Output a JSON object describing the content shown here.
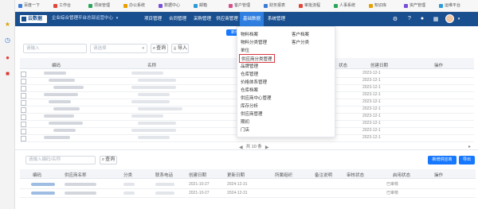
{
  "bookmarks": {
    "items": [
      "百度一下",
      "工作台",
      "项目管理",
      "办公系统",
      "数据中心",
      "邮箱",
      "客户管理",
      "财务报表",
      "审批流程",
      "人事系统",
      "知识库",
      "资产管理",
      "运维平台"
    ]
  },
  "topnav": {
    "brand": "云数据",
    "subtitle": "企业综合管理平台",
    "tenant": "总部运营中心",
    "items": [
      "项目管理",
      "合同管理",
      "采购管理",
      "供应商管理",
      "基础数据",
      "系统管理"
    ],
    "active_index": 4
  },
  "filter": {
    "field1_placeholder": "请输入",
    "field2_placeholder": "请选择",
    "search_label": "查询",
    "import_label": "导入",
    "top_button_label": "新增"
  },
  "dropdown": {
    "col1": [
      "物料档案",
      "物料分类管理",
      "单位",
      "供应商分类管理",
      "品牌管理",
      "仓库管理",
      "价格体系管理",
      "仓库档案",
      "供应商中心管理",
      "库存分析",
      "供应商管理",
      "期初",
      "门店"
    ],
    "col2": [
      "客户档案",
      "客户分类"
    ],
    "highlighted_index": 3
  },
  "upper_table": {
    "headers": [
      "编码",
      "名称",
      "状态",
      "创建日期",
      "操作"
    ],
    "date_prefix": "2023-12-1",
    "rows": 10
  },
  "pagination": {
    "text": "共 10 条"
  },
  "lower": {
    "search_placeholder": "请输入编码/名称",
    "search_label": "查询",
    "add_label": "新增供应商",
    "export_label": "导出",
    "headers": [
      "编码",
      "供应商名称",
      "分类",
      "联系电话",
      "创建日期",
      "更新日期",
      "所属组织",
      "备注说明",
      "审核状态",
      "启用状态",
      "操作"
    ],
    "rows": [
      {
        "date1": "2021-10-27",
        "date2": "2024-12-31",
        "status": "已审核"
      },
      {
        "date1": "2021-10-27",
        "date2": "2024-12-31",
        "status": "已审核"
      }
    ]
  },
  "colors": {
    "nav_bg": "#1a4f8f",
    "nav_active": "#2f7fe0",
    "accent": "#1677ff",
    "highlight_border": "#d9363e"
  }
}
